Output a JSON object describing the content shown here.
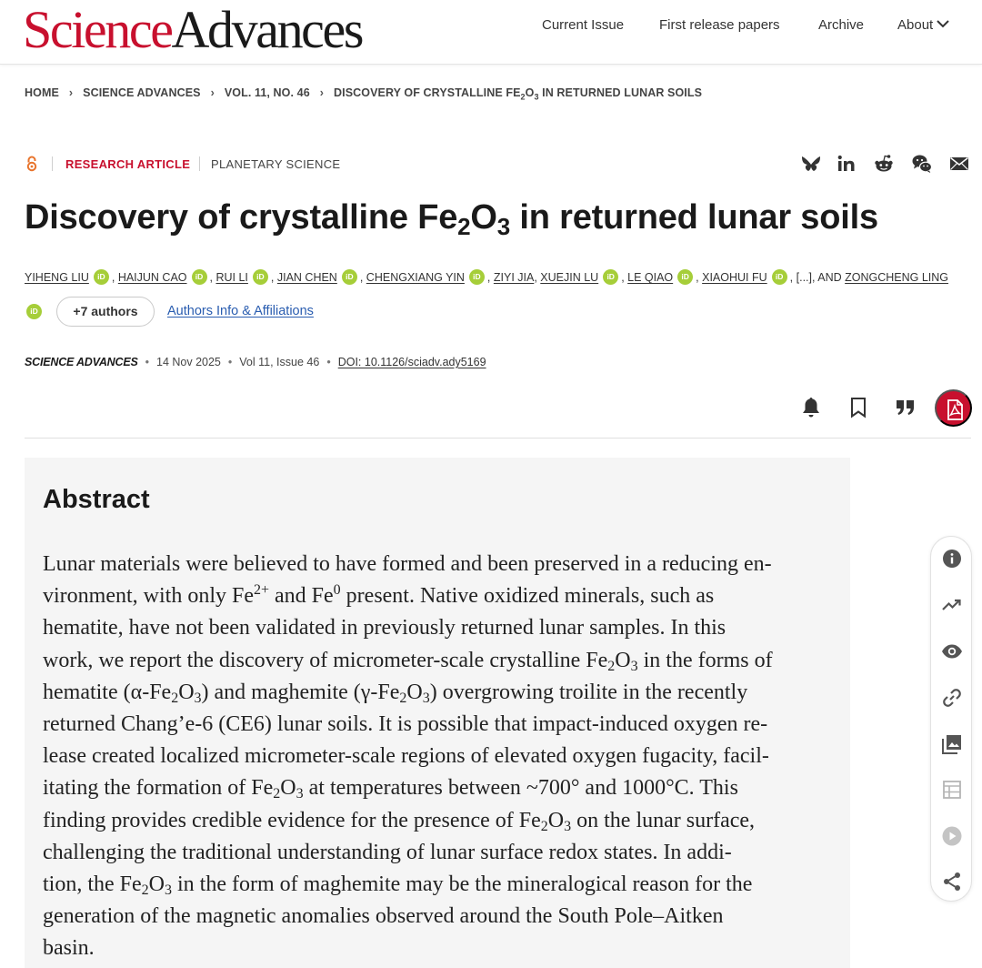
{
  "header": {
    "logo_science": "Science",
    "logo_advances": "Advances",
    "nav": [
      {
        "label": "Current Issue"
      },
      {
        "label": "First release papers"
      },
      {
        "label": "Archive"
      },
      {
        "label": "About"
      }
    ]
  },
  "breadcrumb": [
    "HOME",
    "SCIENCE ADVANCES",
    "VOL. 11, NO. 46",
    "DISCOVERY OF CRYSTALLINE FE",
    "2",
    "O",
    "3",
    " IN RETURNED LUNAR SOILS"
  ],
  "article": {
    "type": "RESEARCH ARTICLE",
    "subject": "PLANETARY SCIENCE",
    "title_parts": [
      "Discovery of crystalline Fe",
      "2",
      "O",
      "3",
      " in returned lunar soils"
    ],
    "authors": [
      "YIHENG LIU",
      "HAIJUN CAO",
      "RUI LI",
      "JIAN CHEN",
      "CHENGXIANG YIN",
      "ZIYI JIA",
      "XUEJIN LU",
      "LE QIAO",
      "XIAOHUI FU",
      "ZONGCHENG LING"
    ],
    "ellipsis": "[...]",
    "and_label": ", AND ",
    "plus_authors": "+7 authors",
    "affiliations_link": "Authors Info & Affiliations",
    "journal": "SCIENCE ADVANCES",
    "date": "14 Nov 2025",
    "volume": "Vol 11, Issue 46",
    "doi": "DOI: 10.1126/sciadv.ady5169"
  },
  "share_icons": [
    "bluesky-icon",
    "linkedin-icon",
    "reddit-icon",
    "wechat-icon",
    "email-icon"
  ],
  "tool_icons": [
    "bell-icon",
    "bookmark-icon",
    "quote-icon",
    "pdf-icon"
  ],
  "side_icons": [
    "info-icon",
    "metrics-icon",
    "view-icon",
    "link-icon",
    "figures-icon",
    "tables-icon",
    "media-icon",
    "share-icon"
  ],
  "abstract": {
    "heading": "Abstract",
    "lines": [
      [
        "Lunar materials were believed to have formed and been preserved in a reducing en-"
      ],
      [
        "vironment, with only Fe",
        {
          "sup": "2+"
        },
        " and Fe",
        {
          "sup": "0"
        },
        " present. Native oxidized minerals, such as"
      ],
      [
        "hematite, have not been validated in previously returned lunar samples. In this"
      ],
      [
        "work, we report the discovery of micrometer-scale crystalline Fe",
        {
          "sub": "2"
        },
        "O",
        {
          "sub": "3"
        },
        " in the forms of"
      ],
      [
        "hematite (α-Fe",
        {
          "sub": "2"
        },
        "O",
        {
          "sub": "3"
        },
        ") and maghemite (γ-Fe",
        {
          "sub": "2"
        },
        "O",
        {
          "sub": "3"
        },
        ") overgrowing troilite in the recently"
      ],
      [
        "returned Chang’e-6 (CE6) lunar soils. It is possible that impact-induced oxygen re-"
      ],
      [
        "lease created localized micrometer-scale regions of elevated oxygen fugacity, facil-"
      ],
      [
        "itating the formation of Fe",
        {
          "sub": "2"
        },
        "O",
        {
          "sub": "3"
        },
        " at temperatures between ~700° and 1000°C. This"
      ],
      [
        "finding provides credible evidence for the presence of Fe",
        {
          "sub": "2"
        },
        "O",
        {
          "sub": "3"
        },
        " on the lunar surface,"
      ],
      [
        "challenging the traditional understanding of lunar surface redox states. In addi-"
      ],
      [
        "tion, the Fe",
        {
          "sub": "2"
        },
        "O",
        {
          "sub": "3"
        },
        " in the form of maghemite may be the mineralogical reason for the"
      ],
      [
        "generation of the magnetic anomalies observed around the South Pole–Aitken"
      ],
      [
        "basin."
      ]
    ]
  },
  "colors": {
    "brand_red": "#c8102e",
    "link_blue": "#2a5db0",
    "orcid_green": "#a6ce39"
  }
}
